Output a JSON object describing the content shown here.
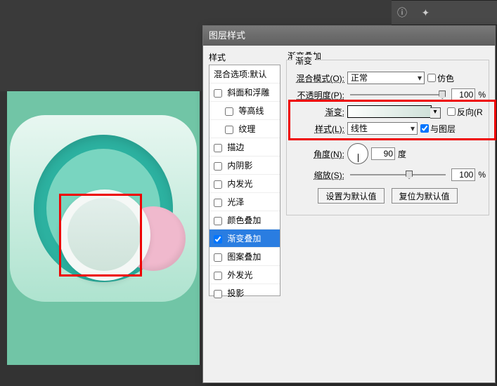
{
  "app": {
    "dialog_title": "图层样式"
  },
  "toolbar": {
    "icons": [
      "info-icon",
      "wand-icon",
      "menu-icon"
    ]
  },
  "styles_panel": {
    "label": "样式",
    "blend_defaults": "混合选项:默认",
    "items": [
      {
        "label": "斜面和浮雕",
        "checked": false,
        "indent": false
      },
      {
        "label": "等高线",
        "checked": false,
        "indent": true
      },
      {
        "label": "纹理",
        "checked": false,
        "indent": true
      },
      {
        "label": "描边",
        "checked": false,
        "indent": false
      },
      {
        "label": "内阴影",
        "checked": false,
        "indent": false
      },
      {
        "label": "内发光",
        "checked": false,
        "indent": false
      },
      {
        "label": "光泽",
        "checked": false,
        "indent": false
      },
      {
        "label": "颜色叠加",
        "checked": false,
        "indent": false
      },
      {
        "label": "渐变叠加",
        "checked": true,
        "indent": false,
        "selected": true
      },
      {
        "label": "图案叠加",
        "checked": false,
        "indent": false
      },
      {
        "label": "外发光",
        "checked": false,
        "indent": false
      },
      {
        "label": "投影",
        "checked": false,
        "indent": false
      }
    ]
  },
  "gradient_overlay": {
    "section_title": "渐变叠加",
    "group_title": "渐变",
    "blend_mode_label": "混合模式(O):",
    "blend_mode_value": "正常",
    "dither_label": "仿色",
    "opacity_label": "不透明度(P):",
    "opacity_value": "100",
    "opacity_unit": "%",
    "gradient_label": "渐变:",
    "reverse_label": "反向(R",
    "style_label": "样式(L):",
    "style_value": "线性",
    "align_label": "与图层",
    "angle_label": "角度(N):",
    "angle_value": "90",
    "angle_unit": "度",
    "scale_label": "缩放(S):",
    "scale_value": "100",
    "scale_unit": "%",
    "set_default_btn": "设置为默认值",
    "reset_default_btn": "复位为默认值"
  },
  "colors": {
    "canvas_bg": "#71c5a6",
    "ring": "#2cb1a0",
    "pink": "#f0b9cd",
    "highlight": "#e00000"
  }
}
